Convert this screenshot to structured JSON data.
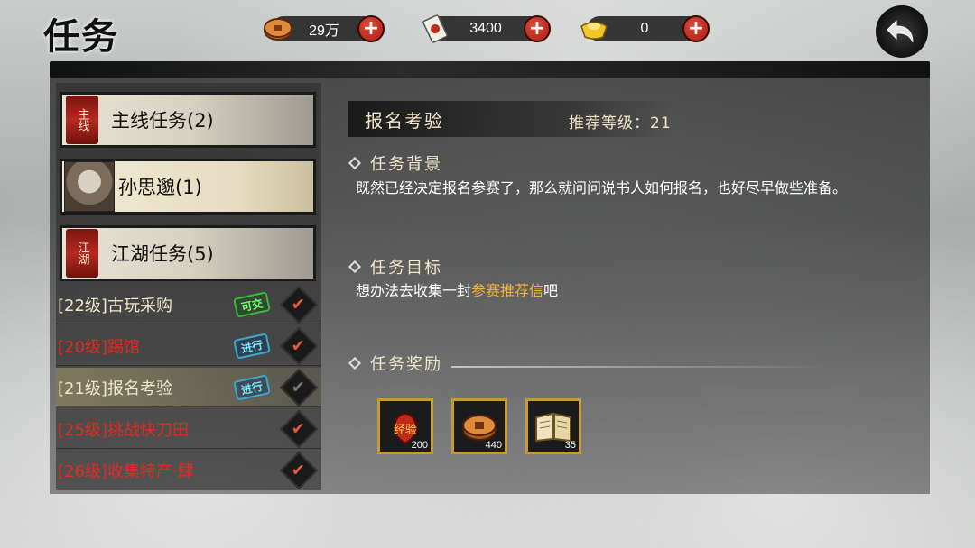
{
  "header": {
    "title": "任务",
    "currencies": [
      {
        "icon": "copper-coin-icon",
        "value": "29万"
      },
      {
        "icon": "ticket-icon",
        "value": "3400"
      },
      {
        "icon": "gold-ingot-icon",
        "value": "0"
      }
    ]
  },
  "categories": [
    {
      "badge": "主线",
      "label": "主线任务(2)"
    },
    {
      "label": "孙思邈(1)"
    },
    {
      "badge": "江湖",
      "label": "江湖任务(5)"
    }
  ],
  "quests": [
    {
      "name": "[22级]古玩采购",
      "status": "可交",
      "color": "#f1e6c8"
    },
    {
      "name": "[20级]踢馆",
      "status": "进行",
      "color": "#e12b20"
    },
    {
      "name": "[21级]报名考验",
      "status": "进行",
      "color": "#f1e6c8"
    },
    {
      "name": "[25级]挑战快刀田",
      "status": "",
      "color": "#e12b20"
    },
    {
      "name": "[26级]收集特产·肆",
      "status": "",
      "color": "#e12b20"
    }
  ],
  "detail": {
    "title": "报名考验",
    "recommended_level": "推荐等级：21",
    "background_heading": "任务背景",
    "background_text": "既然已经决定报名参赛了，那么就问问说书人如何报名，也好尽早做些准备。",
    "objective_heading": "任务目标",
    "objective_prefix": "想办法去收集一封",
    "objective_highlight": "参赛推荐信",
    "objective_suffix": "吧",
    "reward_heading": "任务奖励",
    "rewards": [
      {
        "icon": "experience-bag-icon",
        "label": "经验",
        "amount": "200"
      },
      {
        "icon": "copper-coins-icon",
        "amount": "440"
      },
      {
        "icon": "book-icon",
        "amount": "35"
      }
    ]
  },
  "colors": {
    "accent_gold": "#f5b23a",
    "quest_red": "#e12b20",
    "plus_red": "#c22a1c",
    "reward_border": "#c69a35"
  }
}
